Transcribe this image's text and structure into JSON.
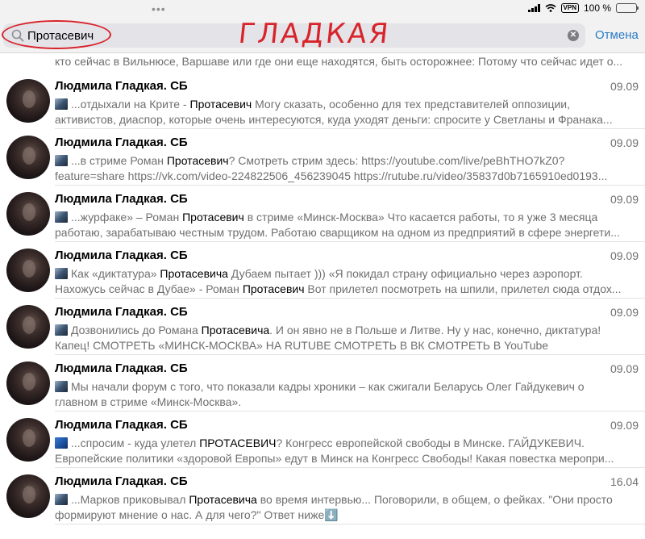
{
  "status_bar": {
    "dots": "•••",
    "vpn": "VPN",
    "battery_percent": "100 %",
    "battery_level": 1.0
  },
  "search": {
    "query": "Протасевич",
    "cancel_label": "Отмена",
    "clear_symbol": "✕"
  },
  "annotation": {
    "handwritten_text": "ГЛАДКАЯ"
  },
  "results": {
    "partial_top": "кто сейчас в Вильнюсе, Варшаве или где они еще находятся, быть осторожнее: Потому что сейчас идет о...",
    "items": [
      {
        "sender": "Людмила Гладкая. СБ",
        "date": "09.09",
        "line1_pre": "...отдыхали на Крите - ",
        "line1_hl": "Протасевич",
        "line1_post": " Могу сказать, особенно для тех представителей оппозиции,",
        "line2": "активистов, диаспор, которые очень интересуются, куда уходят деньги: спросите у Светланы и Франака..."
      },
      {
        "sender": "Людмила Гладкая. СБ",
        "date": "09.09",
        "line1_pre": "...в стриме Роман ",
        "line1_hl": "Протасевич",
        "line1_post": "? Смотреть стрим здесь: https://youtube.com/live/peBhTHO7kZ0?",
        "line2": "feature=share https://vk.com/video-224822506_456239045 https://rutube.ru/video/35837d0b7165910ed0193..."
      },
      {
        "sender": "Людмила Гладкая. СБ",
        "date": "09.09",
        "line1_pre": "...журфаке» – Роман ",
        "line1_hl": "Протасевич",
        "line1_post": " в стриме «Минск-Москва» Что касается работы, то я уже 3 месяца",
        "line2": "работаю, зарабатываю честным трудом. Работаю сварщиком на одном из предприятий в сфере энергети..."
      },
      {
        "sender": "Людмила Гладкая. СБ",
        "date": "09.09",
        "line1_pre": "Как «диктатура» ",
        "line1_hl": "Протасевича",
        "line1_post": " Дубаем пытает ))) «Я покидал страну официально через аэропорт.",
        "line2_pre": "Нахожусь сейчас в Дубае» - Роман ",
        "line2_hl": "Протасевич",
        "line2_post": " Вот прилетел посмотреть на шпили, прилетел сюда отдох..."
      },
      {
        "sender": "Людмила Гладкая. СБ",
        "date": "09.09",
        "line1_pre": "Дозвонились до Романа ",
        "line1_hl": "Протасевича",
        "line1_post": ". И он явно не в Польше и Литве. Ну у нас, конечно, диктатура!",
        "line2": "Капец! СМОТРЕТЬ «МИНСК-МОСКВА» НА RUTUBE СМОТРЕТЬ В ВК СМОТРЕТЬ В YouTube"
      },
      {
        "sender": "Людмила Гладкая. СБ",
        "date": "09.09",
        "line1_pre": "Мы начали форум с того, что показали кадры хроники – как сжигали Беларусь Олег Гайдукевич о",
        "line1_hl": "",
        "line1_post": "",
        "line2": "главном в стриме «Минск-Москва»."
      },
      {
        "sender": "Людмила Гладкая. СБ",
        "date": "09.09",
        "line1_pre": "...спросим - куда улетел ",
        "line1_hl": "ПРОТАСЕВИЧ",
        "line1_post": "? Конгресс европейской свободы в Минске. ГАЙДУКЕВИЧ.",
        "line2": "Европейские политики «здоровой Европы» едут в Минск на Конгресс Свободы! Какая повестка меропри..."
      },
      {
        "sender": "Людмила Гладкая. СБ",
        "date": "16.04",
        "line1_pre": "...Марков приковывал  ",
        "line1_hl": "Протасевича",
        "line1_post": " во время интервью...  Поговорили, в общем, о фейках.  \"Они просто",
        "line2": "формируют мнение о нас. А для чего?\" Ответ ниже⬇️"
      }
    ]
  }
}
